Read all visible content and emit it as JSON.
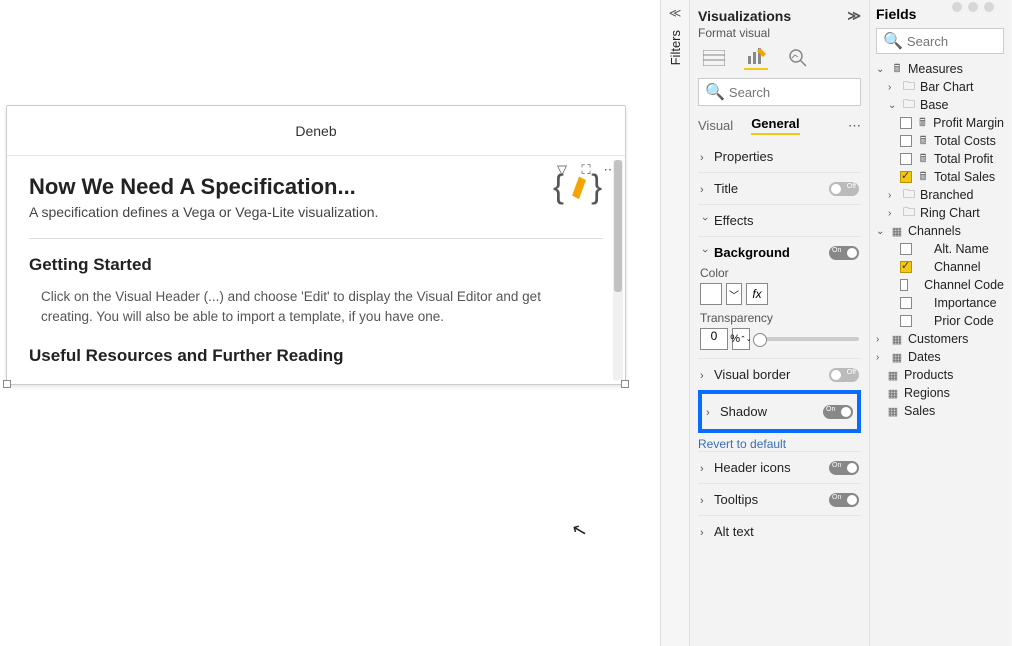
{
  "canvas": {
    "visual_title": "Deneb",
    "spec_heading": "Now We Need A Specification...",
    "spec_sub": "A specification defines a Vega or Vega-Lite visualization.",
    "getting_started_heading": "Getting Started",
    "getting_started_body": "Click on the Visual Header (...) and choose 'Edit' to display the Visual Editor and get creating. You will also be able to import a template, if you have one.",
    "resources_heading": "Useful Resources and Further Reading"
  },
  "filters_tab": {
    "label": "Filters"
  },
  "viz_pane": {
    "title": "Visualizations",
    "subtitle": "Format visual",
    "search_placeholder": "Search",
    "tab_visual": "Visual",
    "tab_general": "General",
    "rows": {
      "properties": "Properties",
      "title": "Title",
      "effects": "Effects",
      "background": "Background",
      "color_label": "Color",
      "transparency_label": "Transparency",
      "transparency_value": "0",
      "visual_border": "Visual border",
      "shadow": "Shadow",
      "reset": "Revert to default",
      "header_icons": "Header icons",
      "tooltips": "Tooltips",
      "alt_text": "Alt text"
    },
    "toggles": {
      "title": "Off",
      "background": "On",
      "visual_border": "Off",
      "shadow": "On",
      "header_icons": "On",
      "tooltips": "On"
    }
  },
  "fields_pane": {
    "title": "Fields",
    "search_placeholder": "Search",
    "tree": {
      "measures": "Measures",
      "bar_chart": "Bar Chart",
      "base": "Base",
      "profit_margin": "Profit Margin",
      "total_costs": "Total Costs",
      "total_profit": "Total Profit",
      "total_sales": "Total Sales",
      "branched": "Branched",
      "ring_chart": "Ring Chart",
      "channels": "Channels",
      "alt_name": "Alt. Name",
      "channel": "Channel",
      "channel_code": "Channel Code",
      "importance": "Importance",
      "prior_code": "Prior Code",
      "customers": "Customers",
      "dates": "Dates",
      "products": "Products",
      "regions": "Regions",
      "sales": "Sales"
    }
  }
}
